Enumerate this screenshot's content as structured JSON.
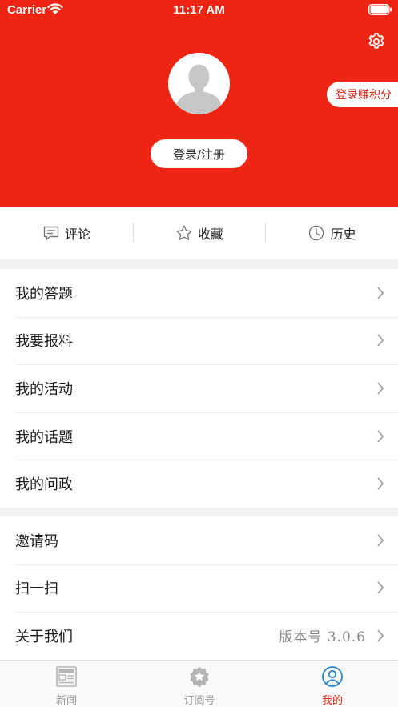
{
  "status_bar": {
    "carrier": "Carrier",
    "time": "11:17 AM"
  },
  "header": {
    "background": "#ee2512",
    "login_label": "登录/注册",
    "points_label": "登录赚积分"
  },
  "quick_actions": [
    {
      "label": "评论",
      "icon": "comment-icon"
    },
    {
      "label": "收藏",
      "icon": "star-icon"
    },
    {
      "label": "历史",
      "icon": "clock-icon"
    }
  ],
  "menu_primary": [
    {
      "label": "我的答题"
    },
    {
      "label": "我要报料"
    },
    {
      "label": "我的活动"
    },
    {
      "label": "我的话题"
    },
    {
      "label": "我的问政"
    }
  ],
  "menu_secondary": [
    {
      "label": "邀请码"
    },
    {
      "label": "扫一扫"
    },
    {
      "label": "关于我们",
      "value": "版本号 3.0.6"
    }
  ],
  "tabs": [
    {
      "label": "新闻",
      "icon": "newspaper-icon",
      "active": false
    },
    {
      "label": "订阅号",
      "icon": "subscribe-icon",
      "active": false
    },
    {
      "label": "我的",
      "icon": "profile-icon",
      "active": true
    }
  ],
  "colors": {
    "accent": "#ee2512",
    "active_tab": "#e02312"
  }
}
